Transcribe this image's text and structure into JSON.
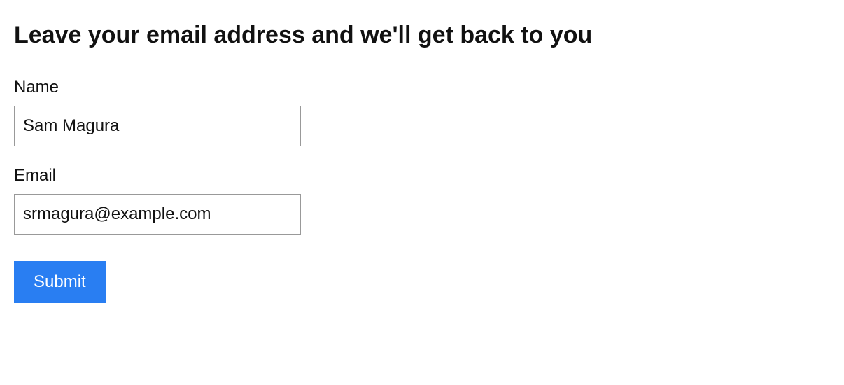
{
  "heading": "Leave your email address and we'll get back to you",
  "form": {
    "name": {
      "label": "Name",
      "value": "Sam Magura"
    },
    "email": {
      "label": "Email",
      "value": "srmagura@example.com"
    },
    "submit_label": "Submit"
  }
}
